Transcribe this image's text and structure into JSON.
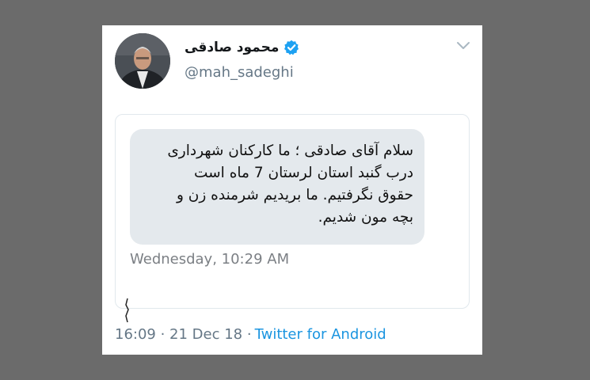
{
  "tweet": {
    "display_name": "محمود صادقی",
    "handle": "@mah_sadeghi",
    "verified": true,
    "verified_color": "#1da1f2",
    "timestamp": "16:09 · 21 Dec 18 ·",
    "source": "Twitter for Android",
    "source_color": "#1b95e0"
  },
  "sms": {
    "message": "سلام آقای صادقی ؛ ما کارکنان شهرداری\nدرب گنبد استان لرستان 7 ماه است\nحقوق نگرفتیم. ما بریدیم شرمنده زن و\nبچه مون شدیم.",
    "time": "Wednesday, 10:29 AM",
    "bubble_color": "#e4e9ed"
  },
  "icons": {
    "verified": "verified-badge-icon",
    "caret": "chevron-down-icon"
  }
}
